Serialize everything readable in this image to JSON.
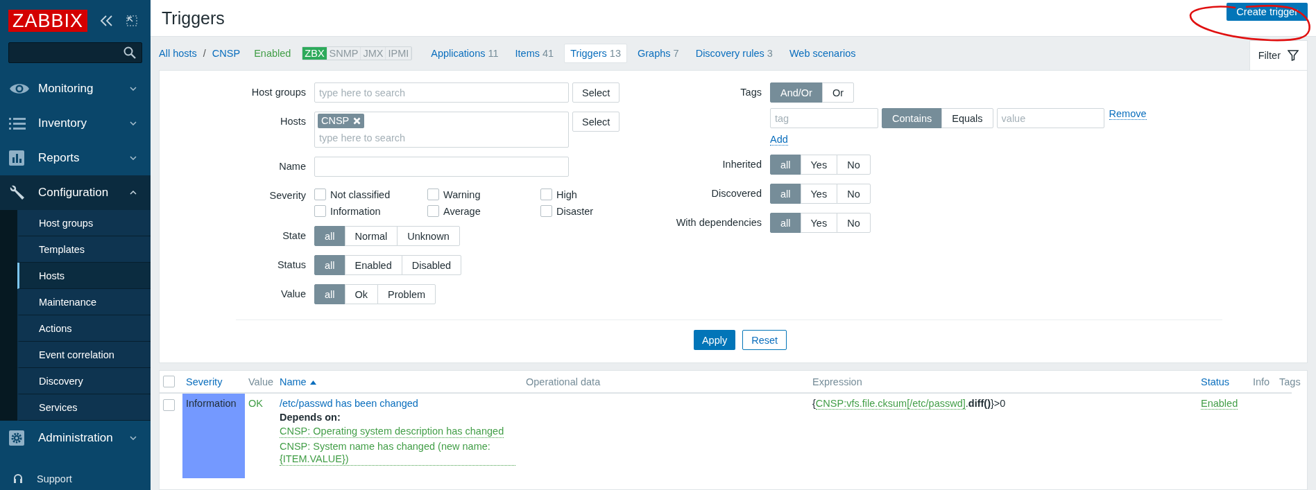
{
  "sidebar": {
    "logo": "ZABBIX",
    "menu": [
      {
        "label": "Monitoring",
        "expanded": false
      },
      {
        "label": "Inventory",
        "expanded": false
      },
      {
        "label": "Reports",
        "expanded": false
      },
      {
        "label": "Configuration",
        "expanded": true,
        "children": [
          {
            "label": "Host groups",
            "selected": false
          },
          {
            "label": "Templates",
            "selected": false
          },
          {
            "label": "Hosts",
            "selected": true
          },
          {
            "label": "Maintenance",
            "selected": false
          },
          {
            "label": "Actions",
            "selected": false
          },
          {
            "label": "Event correlation",
            "selected": false
          },
          {
            "label": "Discovery",
            "selected": false
          },
          {
            "label": "Services",
            "selected": false
          }
        ]
      },
      {
        "label": "Administration",
        "expanded": false
      }
    ],
    "footer": "Support"
  },
  "header": {
    "title": "Triggers",
    "button": "Create trigger"
  },
  "host_nav": {
    "breadcrumbs": [
      "All hosts",
      "CNSP"
    ],
    "separator": "/",
    "status": "Enabled",
    "interfaces": [
      {
        "label": "ZBX",
        "on": true
      },
      {
        "label": "SNMP",
        "on": false
      },
      {
        "label": "JMX",
        "on": false
      },
      {
        "label": "IPMI",
        "on": false
      }
    ],
    "tabs": [
      {
        "label": "Applications",
        "count": "11",
        "selected": false
      },
      {
        "label": "Items",
        "count": "41",
        "selected": false
      },
      {
        "label": "Triggers",
        "count": "13",
        "selected": true
      },
      {
        "label": "Graphs",
        "count": "7",
        "selected": false
      },
      {
        "label": "Discovery rules",
        "count": "3",
        "selected": false
      },
      {
        "label": "Web scenarios",
        "selected": false
      }
    ],
    "filter_tab": "Filter"
  },
  "filter": {
    "left": [
      {
        "kind": "multiselect",
        "label": "Host groups",
        "placeholder": "type here to search",
        "button": "Select"
      },
      {
        "kind": "multiselect",
        "label": "Hosts",
        "chips": [
          "CNSP"
        ],
        "placeholder": "type here to search",
        "button": "Select"
      },
      {
        "kind": "text",
        "label": "Name"
      },
      {
        "kind": "checkboxes",
        "label": "Severity",
        "options": [
          {
            "label": "Not classified",
            "checked": false
          },
          {
            "label": "Warning",
            "checked": false
          },
          {
            "label": "High",
            "checked": false
          },
          {
            "label": "Information",
            "checked": false
          },
          {
            "label": "Average",
            "checked": false
          },
          {
            "label": "Disaster",
            "checked": false
          }
        ]
      },
      {
        "kind": "segmented",
        "label": "State",
        "options": [
          {
            "label": "all",
            "selected": true
          },
          {
            "label": "Normal",
            "selected": false
          },
          {
            "label": "Unknown",
            "selected": false
          }
        ]
      },
      {
        "kind": "segmented",
        "label": "Status",
        "options": [
          {
            "label": "all",
            "selected": true
          },
          {
            "label": "Enabled",
            "selected": false
          },
          {
            "label": "Disabled",
            "selected": false
          }
        ]
      },
      {
        "kind": "segmented",
        "label": "Value",
        "options": [
          {
            "label": "all",
            "selected": true
          },
          {
            "label": "Ok",
            "selected": false
          },
          {
            "label": "Problem",
            "selected": false
          }
        ]
      }
    ],
    "right": [
      {
        "kind": "tags",
        "label": "Tags",
        "operator": [
          {
            "label": "And/Or",
            "selected": true
          },
          {
            "label": "Or",
            "selected": false
          }
        ],
        "tag_placeholder": "tag",
        "match": [
          {
            "label": "Contains",
            "selected": true
          },
          {
            "label": "Equals",
            "selected": false
          }
        ],
        "value_placeholder": "value",
        "remove": "Remove",
        "add": "Add"
      },
      {
        "kind": "segmented",
        "label": "Inherited",
        "options": [
          {
            "label": "all",
            "selected": true
          },
          {
            "label": "Yes",
            "selected": false
          },
          {
            "label": "No",
            "selected": false
          }
        ]
      },
      {
        "kind": "segmented",
        "label": "Discovered",
        "options": [
          {
            "label": "all",
            "selected": true
          },
          {
            "label": "Yes",
            "selected": false
          },
          {
            "label": "No",
            "selected": false
          }
        ]
      },
      {
        "kind": "segmented",
        "label": "With dependencies",
        "options": [
          {
            "label": "all",
            "selected": true
          },
          {
            "label": "Yes",
            "selected": false
          },
          {
            "label": "No",
            "selected": false
          }
        ]
      }
    ],
    "apply": "Apply",
    "reset": "Reset"
  },
  "table": {
    "header_checked": false,
    "columns": [
      {
        "label": "Severity",
        "sortable": true,
        "sorted": false
      },
      {
        "label": "Value",
        "sortable": false,
        "sorted": false
      },
      {
        "label": "Name",
        "sortable": true,
        "sorted": true
      },
      {
        "label": "Operational data",
        "sortable": false,
        "sorted": false
      },
      {
        "label": "Expression",
        "sortable": false,
        "sorted": false
      },
      {
        "label": "Status",
        "sortable": true,
        "sorted": false
      },
      {
        "label": "Info",
        "sortable": false,
        "sorted": false
      },
      {
        "label": "Tags",
        "sortable": false,
        "sorted": false
      }
    ],
    "rows": [
      {
        "checked": false,
        "severity": "Information",
        "color": "#7499ff",
        "value": "OK",
        "name": "/etc/passwd has been changed",
        "depends_label": "Depends on:",
        "depends": [
          "CNSP: Operating system description has changed",
          "CNSP: System name has changed (new name: {ITEM.VALUE})"
        ],
        "expression": [
          {
            "kind": "text",
            "text": "{"
          },
          {
            "kind": "link",
            "text": "CNSP:vfs.file.cksum[/etc/passwd]"
          },
          {
            "kind": "text",
            "text": "."
          },
          {
            "kind": "function",
            "text": "diff()"
          },
          {
            "kind": "text",
            "text": "}>0"
          }
        ],
        "status": "Enabled"
      }
    ]
  }
}
